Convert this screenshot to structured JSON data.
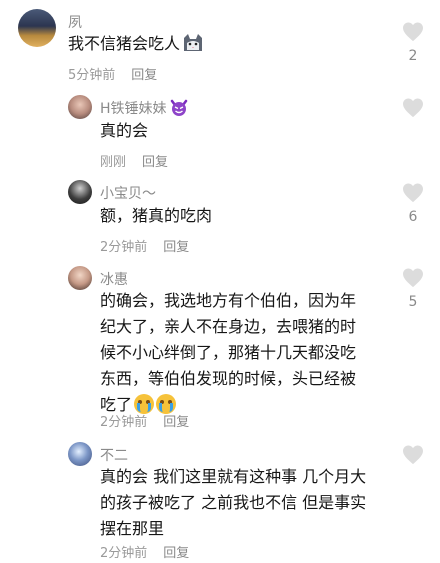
{
  "comments": [
    {
      "user": "夙",
      "text": "我不信猪会吃人",
      "text_emoji": "cat-emoji",
      "time": "5分钟前",
      "reply_label": "回复",
      "likes": "2"
    },
    {
      "user": "H铁锤妹妹",
      "user_emoji": "devil-emoji",
      "text": "真的会",
      "time": "刚刚",
      "reply_label": "回复",
      "likes": ""
    },
    {
      "user": "小宝贝～",
      "text": "额，猪真的吃肉",
      "time": "2分钟前",
      "reply_label": "回复",
      "likes": "6"
    },
    {
      "user": "冰惠",
      "text_lines": [
        "的确会，我选地方有个伯伯，因为年",
        "纪大了，亲人不在身边，去喂猪的时",
        "候不小心绊倒了，那猪十几天都没吃",
        "东西，等伯伯发现的时候，头已经被",
        "吃了"
      ],
      "text_emoji": "crying-emoji",
      "time": "2分钟前",
      "reply_label": "回复",
      "likes": "5"
    },
    {
      "user": "不二",
      "text_lines": [
        "真的会 我们这里就有这种事 几个月大",
        "的孩子被吃了 之前我也不信 但是事实",
        "摆在那里"
      ],
      "time": "2分钟前",
      "reply_label": "回复",
      "likes": ""
    }
  ]
}
